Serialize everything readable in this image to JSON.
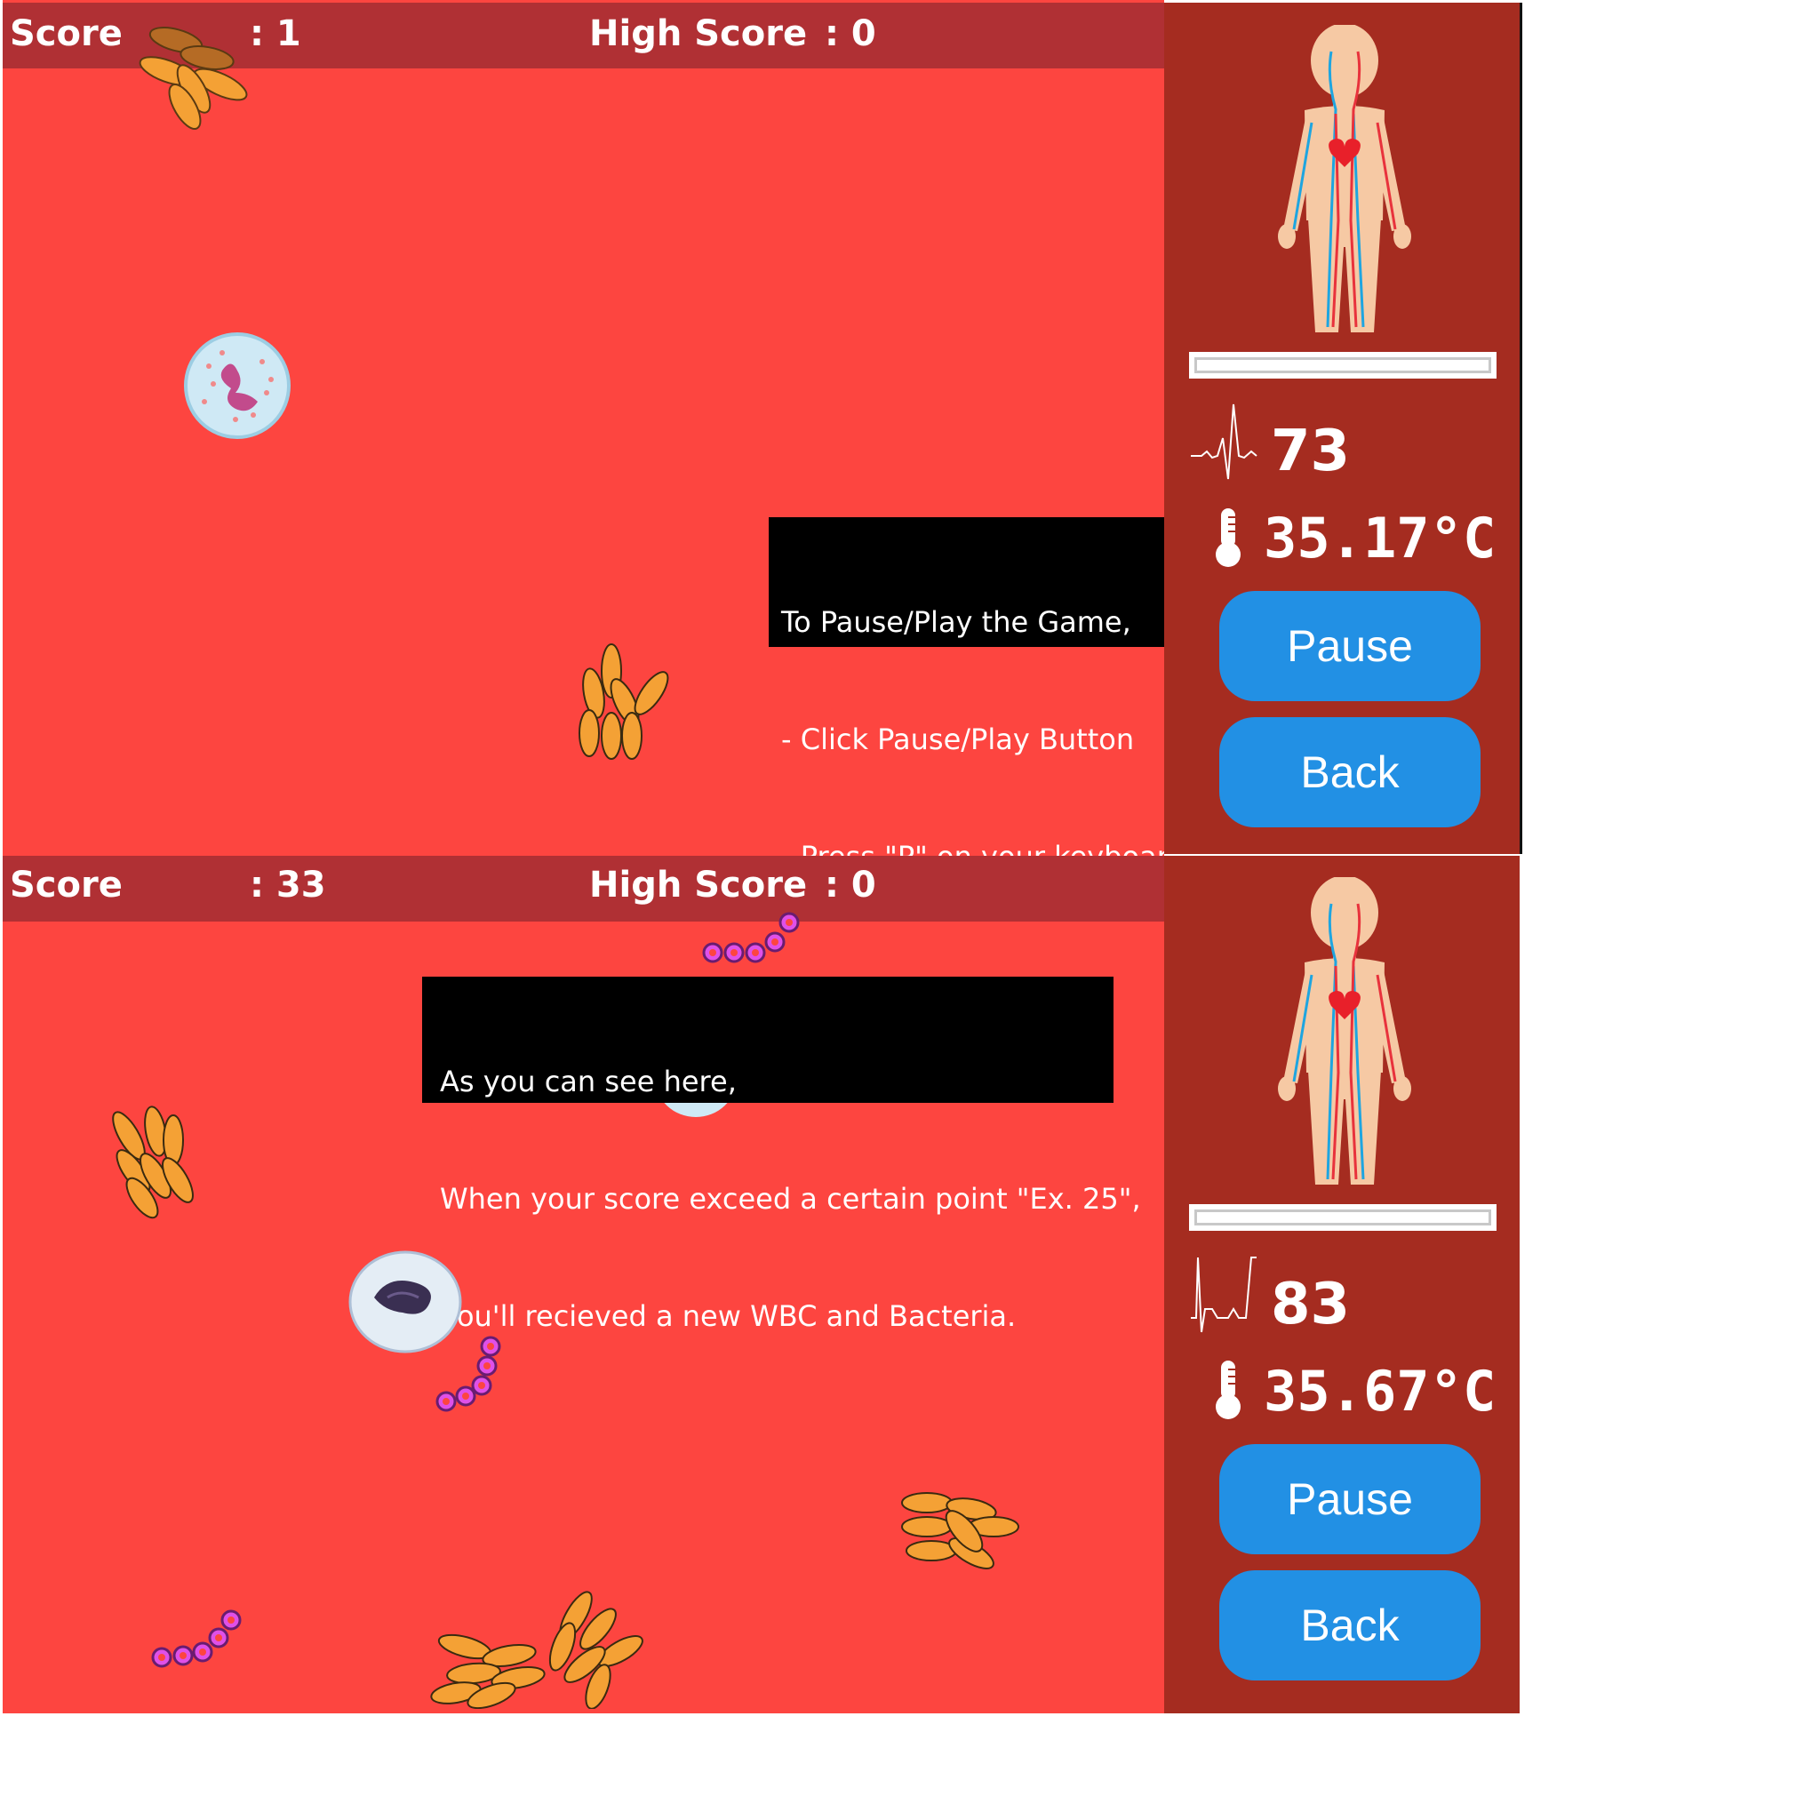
{
  "panels": [
    {
      "score_label": "Score",
      "score_value": ": 1",
      "high_score_label": "High Score",
      "high_score_value": ": 0",
      "heart_rate": "73",
      "temperature": "35.17°C",
      "pause_label": "Pause",
      "back_label": "Back",
      "tooltip_lines": [
        "To Pause/Play the Game,",
        "- Click Pause/Play Button",
        "- Press \"P\" on your keyboard"
      ]
    },
    {
      "score_label": "Score",
      "score_value": ": 33",
      "high_score_label": "High Score",
      "high_score_value": ": 0",
      "heart_rate": "83",
      "temperature": "35.67°C",
      "pause_label": "Pause",
      "back_label": "Back",
      "tooltip_lines": [
        "As you can see here,",
        "When your score exceed a certain point \"Ex. 25\",",
        "you'll recieved a new WBC and Bacteria."
      ]
    }
  ],
  "colors": {
    "field": "#fd4540",
    "topbar": "#b03034",
    "sidebar": "#a52c20",
    "button": "#2290e4",
    "bacteria_orange": "#f4a135",
    "bacteria_purple": "#c23cc8"
  },
  "icons": [
    "human-body-icon",
    "heartbeat-icon",
    "thermometer-icon",
    "wbc-icon",
    "bacteria-icon"
  ]
}
